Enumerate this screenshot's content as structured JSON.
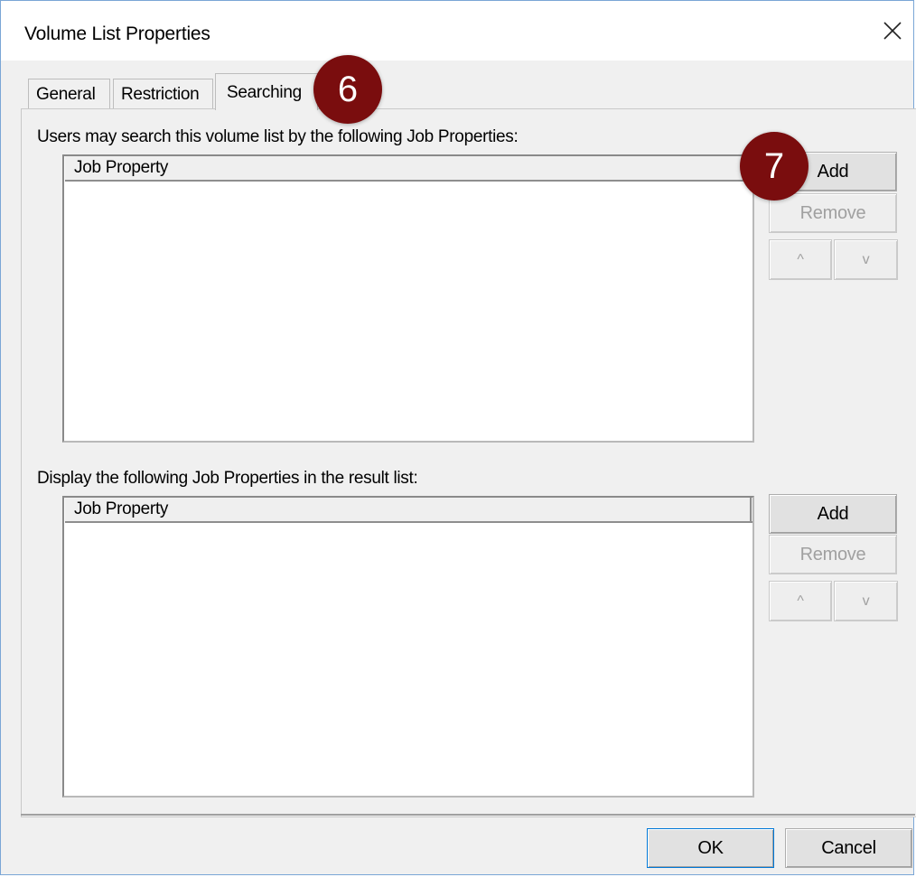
{
  "window": {
    "title": "Volume List Properties"
  },
  "tabs": [
    {
      "label": "General"
    },
    {
      "label": "Restriction"
    },
    {
      "label": "Searching"
    }
  ],
  "search_section": {
    "label": "Users may search this volume list by the following Job Properties:",
    "column_header": "Job Property",
    "add_label": "Add",
    "remove_label": "Remove",
    "up_label": "^",
    "down_label": "v"
  },
  "display_section": {
    "label": "Display the following Job Properties in the result list:",
    "column_header": "Job Property",
    "add_label": "Add",
    "remove_label": "Remove",
    "up_label": "^",
    "down_label": "v"
  },
  "footer": {
    "ok_label": "OK",
    "cancel_label": "Cancel"
  },
  "callouts": [
    {
      "number": "6",
      "color": "#7a0d0e"
    },
    {
      "number": "7",
      "color": "#7a0d0e"
    }
  ]
}
